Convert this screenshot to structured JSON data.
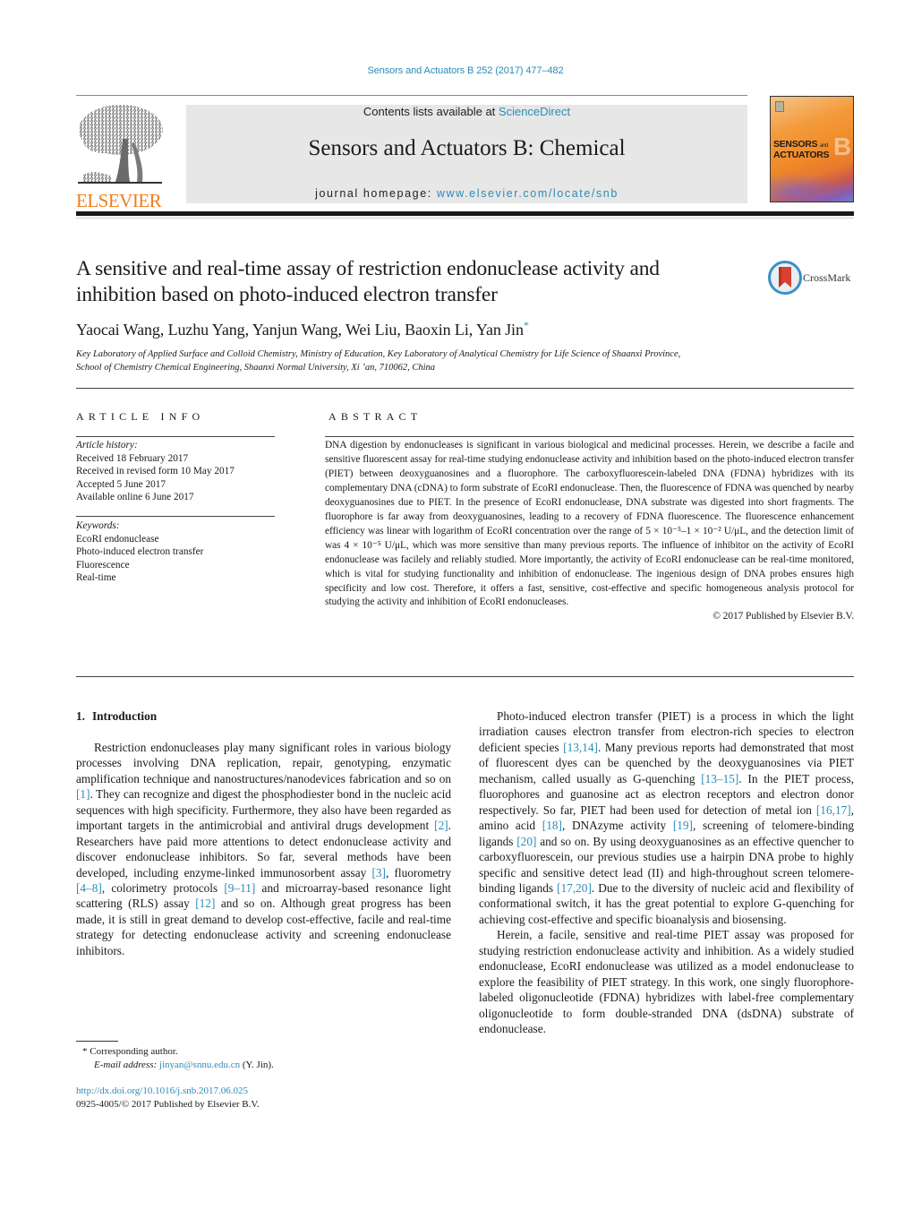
{
  "header": {
    "running_head": "Sensors and Actuators B 252 (2017) 477–482",
    "publisher_logo_text": "ELSEVIER",
    "contents_prefix": "Contents lists available at ",
    "contents_link": "ScienceDirect",
    "journal_title": "Sensors and Actuators B: Chemical",
    "homepage_prefix": "journal homepage: ",
    "homepage_link": "www.elsevier.com/locate/snb",
    "cover": {
      "line1": "SENSORS",
      "and": "and",
      "line2": "ACTUATORS",
      "letter": "B"
    }
  },
  "article": {
    "title": "A sensitive and real-time assay of restriction endonuclease activity and inhibition based on photo-induced electron transfer",
    "crossmark_label": "CrossMark",
    "authors": "Yaocai Wang, Luzhu Yang, Yanjun Wang, Wei Liu, Baoxin Li, Yan Jin",
    "corresponding_marker": "*",
    "affiliation_line1": "Key Laboratory of Applied Surface and Colloid Chemistry, Ministry of Education, Key Laboratory of Analytical Chemistry for Life Science of Shaanxi Province,",
    "affiliation_line2": "School of Chemistry Chemical Engineering, Shaanxi Normal University, Xi ’an, 710062, China"
  },
  "article_info": {
    "heading": "ARTICLE INFO",
    "history_label": "Article history:",
    "history": [
      "Received 18 February 2017",
      "Received in revised form 10 May 2017",
      "Accepted 5 June 2017",
      "Available online 6 June 2017"
    ],
    "keywords_label": "Keywords:",
    "keywords": [
      "EcoRI endonuclease",
      "Photo-induced electron transfer",
      "Fluorescence",
      "Real-time"
    ]
  },
  "abstract": {
    "heading": "ABSTRACT",
    "text": "DNA digestion by endonucleases is significant in various biological and medicinal processes. Herein, we describe a facile and sensitive fluorescent assay for real-time studying endonuclease activity and inhibition based on the photo-induced electron transfer (PIET) between deoxyguanosines and a fluorophore. The carboxyfluorescein-labeled DNA (FDNA) hybridizes with its complementary DNA (cDNA) to form substrate of EcoRI endonuclease. Then, the fluorescence of FDNA was quenched by nearby deoxyguanosines due to PIET. In the presence of EcoRI endonuclease, DNA substrate was digested into short fragments. The fluorophore is far away from deoxyguanosines, leading to a recovery of FDNA fluorescence. The fluorescence enhancement efficiency was linear with logarithm of EcoRI concentration over the range of 5 × 10⁻⁵–1 × 10⁻² U/μL, and the detection limit of was 4 × 10⁻⁵ U/μL, which was more sensitive than many previous reports. The influence of inhibitor on the activity of EcoRI endonuclease was facilely and reliably studied. More importantly, the activity of EcoRI endonuclease can be real-time monitored, which is vital for studying functionality and inhibition of endonuclease. The ingenious design of DNA probes ensures high specificity and low cost. Therefore, it offers a fast, sensitive, cost-effective and specific homogeneous analysis protocol for studying the activity and inhibition of EcoRI endonucleases.",
    "copyright": "© 2017 Published by Elsevier B.V."
  },
  "body": {
    "section_number": "1.",
    "section_title": "Introduction",
    "left_para": [
      {
        "t": "Restriction endonucleases play many significant roles in various biology processes involving DNA replication, repair, genotyping, enzymatic amplification technique and nanostructures/nanodevices fabrication and so on "
      },
      {
        "ref": "[1]"
      },
      {
        "t": ". They can recognize and digest the phosphodiester bond in the nucleic acid sequences with high specificity. Furthermore, they also have been regarded as important targets in the antimicrobial and antiviral drugs development "
      },
      {
        "ref": "[2]"
      },
      {
        "t": ". Researchers have paid more attentions to detect endonuclease activity and discover endonuclease inhibitors. So far, several methods have been developed, including enzyme-linked immunosorbent assay "
      },
      {
        "ref": "[3]"
      },
      {
        "t": ", fluorometry "
      },
      {
        "ref": "[4–8]"
      },
      {
        "t": ", colorimetry protocols "
      },
      {
        "ref": "[9–11]"
      },
      {
        "t": " and microarray-based resonance light scattering (RLS) assay "
      },
      {
        "ref": "[12]"
      },
      {
        "t": " and so on. Although great progress has been made, it is still in great demand to develop cost-effective, facile and real-time strategy for detecting endonuclease activity and screening endonuclease inhibitors."
      }
    ],
    "right_para1": [
      {
        "t": "Photo-induced electron transfer (PIET) is a process in which the light irradiation causes electron transfer from electron-rich species to electron deficient species "
      },
      {
        "ref": "[13,14]"
      },
      {
        "t": ". Many previous reports had demonstrated that most of fluorescent dyes can be quenched by the deoxyguanosines via PIET mechanism, called usually as G-quenching "
      },
      {
        "ref": "[13–15]"
      },
      {
        "t": ". In the PIET process, fluorophores and guanosine act as electron receptors and electron donor respectively. So far, PIET had been used for detection of metal ion "
      },
      {
        "ref": "[16,17]"
      },
      {
        "t": ", amino acid "
      },
      {
        "ref": "[18]"
      },
      {
        "t": ", DNAzyme activity "
      },
      {
        "ref": "[19]"
      },
      {
        "t": ", screening of telomere-binding ligands "
      },
      {
        "ref": "[20]"
      },
      {
        "t": " and so on. By using deoxyguanosines as an effective quencher to carboxyfluorescein, our previous studies use a hairpin DNA probe to highly specific and sensitive detect lead (II) and high-throughout screen telomere-binding ligands "
      },
      {
        "ref": "[17,20]"
      },
      {
        "t": ". Due to the diversity of nucleic acid and flexibility of conformational switch, it has the great potential to explore G-quenching for achieving cost-effective and specific bioanalysis and biosensing."
      }
    ],
    "right_para2": [
      {
        "t": "Herein, a facile, sensitive and real-time PIET assay was proposed for studying restriction endonuclease activity and inhibition. As a widely studied endonuclease, EcoRI endonuclease was utilized as a model endonuclease to explore the feasibility of PIET strategy. In this work, one singly fluorophore-labeled oligonucleotide (FDNA) hybridizes with label-free complementary oligonucleotide to form double-stranded DNA (dsDNA) substrate of endonuclease."
      }
    ]
  },
  "footnotes": {
    "marker": "*",
    "corresponding": "Corresponding author.",
    "email_label": "E-mail address:",
    "email": "jinyan@snnu.edu.cn",
    "email_suffix": " (Y. Jin).",
    "doi": "http://dx.doi.org/10.1016/j.snb.2017.06.025",
    "issn_line": "0925-4005/© 2017 Published by Elsevier B.V."
  },
  "colors": {
    "link": "#2a8cb8",
    "elsevier_orange": "#f07d1a",
    "banner_bg": "#e7e7e7",
    "crossmark_red": "#d8412f",
    "crossmark_ring": "#3a8fc8"
  }
}
